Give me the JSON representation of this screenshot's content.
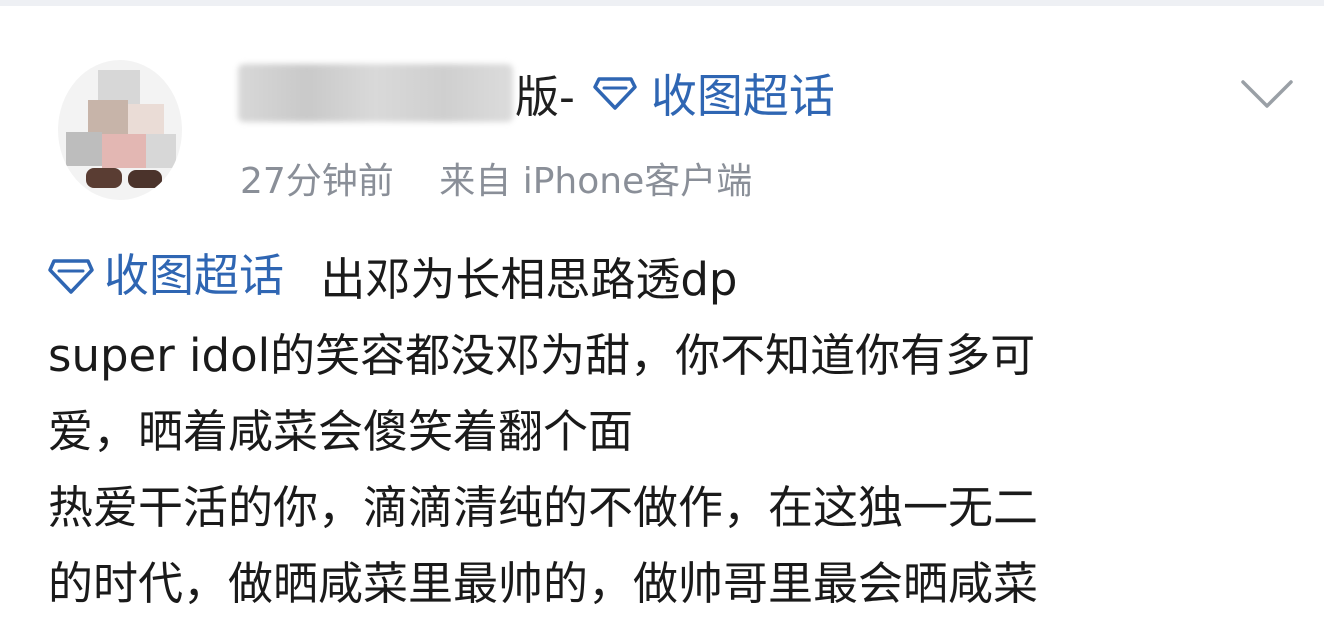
{
  "post": {
    "username_suffix": "版-",
    "super_topic": "收图超话",
    "time": "27分钟前",
    "source": "来自 iPhone客户端"
  },
  "content": {
    "topic_tag": "收图超话",
    "title": "出邓为长相思路透dp",
    "lines": [
      "super idol的笑容都没邓为甜，你不知道你有多可",
      "爱，晒着咸菜会傻笑着翻个面",
      "热爱干活的你，滴滴清纯的不做作，在这独一无二",
      "的时代，做晒咸菜里最帅的，做帅哥里最会晒咸菜"
    ]
  },
  "colors": {
    "link": "#2f66b3",
    "meta": "#8a8f98",
    "text": "#1a1a1a"
  },
  "icons": {
    "topic": "diamond-icon",
    "menu": "chevron-down-icon"
  }
}
